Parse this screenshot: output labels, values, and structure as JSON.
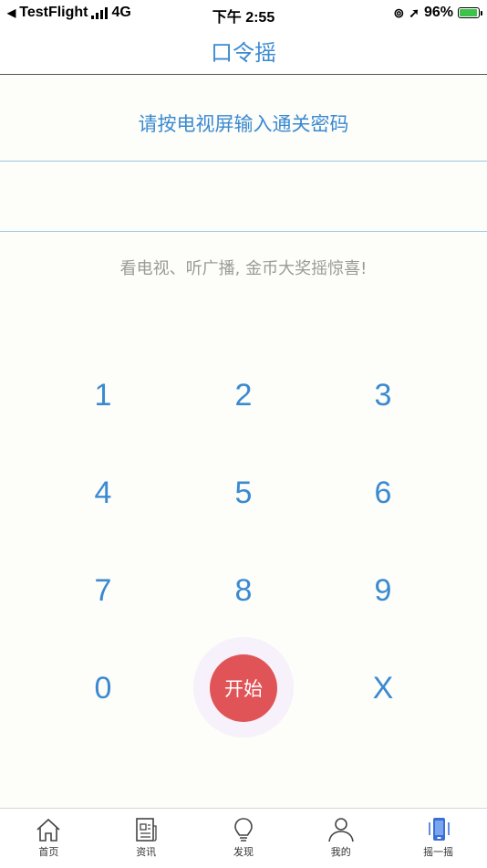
{
  "status_bar": {
    "back_app": "TestFlight",
    "network": "4G",
    "time": "下午 2:55",
    "battery": "96%",
    "battery_level": 0.96
  },
  "nav": {
    "title": "口令摇"
  },
  "prompt": "请按电视屏输入通关密码",
  "password": {
    "value": "",
    "placeholder": ""
  },
  "hint": "看电视、听广播, 金币大奖摇惊喜!",
  "keypad": {
    "keys": [
      "1",
      "2",
      "3",
      "4",
      "5",
      "6",
      "7",
      "8",
      "9",
      "0",
      "X"
    ],
    "start_label": "开始"
  },
  "tabs": [
    {
      "label": "首页",
      "icon": "home-icon"
    },
    {
      "label": "资讯",
      "icon": "news-icon"
    },
    {
      "label": "发现",
      "icon": "lightbulb-icon"
    },
    {
      "label": "我的",
      "icon": "user-icon"
    },
    {
      "label": "摇一摇",
      "icon": "shake-phone-icon",
      "active": true
    }
  ],
  "colors": {
    "accent": "#3a8ad1",
    "start_button": "#e05457",
    "hint": "#9a9a9a",
    "background": "#fdfdf9"
  }
}
